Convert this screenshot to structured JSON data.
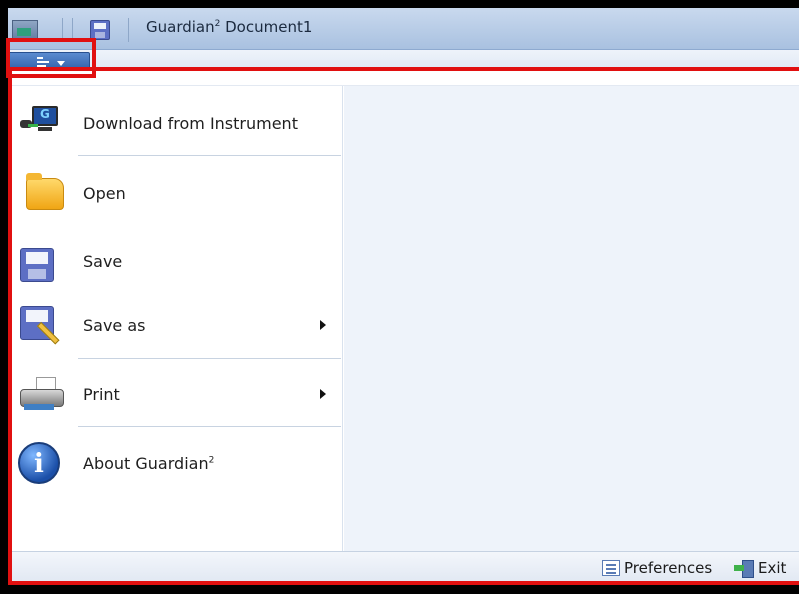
{
  "window": {
    "title_main": "Guardian",
    "title_sup": "2",
    "title_rest": " Document1"
  },
  "menu": {
    "items": [
      {
        "label": "Download from Instrument",
        "icon": "download-instrument-icon",
        "has_submenu": false
      },
      {
        "label": "Open",
        "icon": "folder-icon",
        "has_submenu": false
      },
      {
        "label": "Save",
        "icon": "floppy-disk-icon",
        "has_submenu": false
      },
      {
        "label": "Save as",
        "icon": "save-as-icon",
        "has_submenu": true
      },
      {
        "label": "Print",
        "icon": "printer-icon",
        "has_submenu": true
      },
      {
        "label_main": "About Guardian",
        "label_sup": "2",
        "icon": "info-icon",
        "has_submenu": false
      }
    ]
  },
  "footer": {
    "preferences_label": "Preferences",
    "exit_label": "Exit"
  },
  "colors": {
    "annotation_red": "#e11010",
    "app_button_blue": "#2f5fa8",
    "right_pane_bg": "#eef3fa"
  }
}
